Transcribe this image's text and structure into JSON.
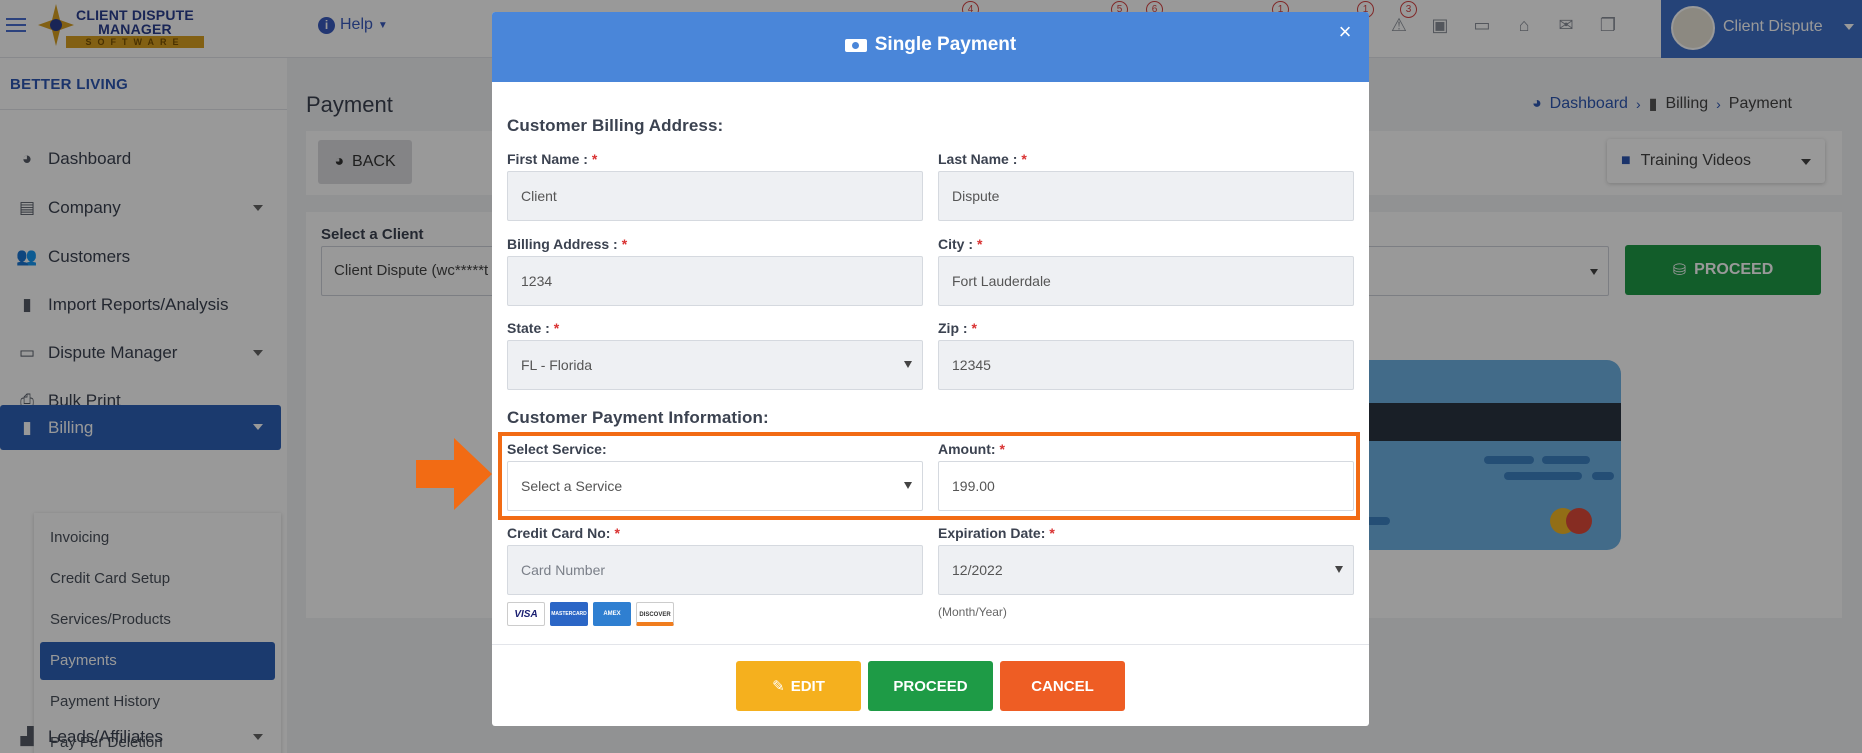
{
  "topbar": {
    "logo_line1": "CLIENT DISPUTE",
    "logo_line2": "MANAGER",
    "logo_line3": "SOFTWARE",
    "help_label": "Help",
    "badges": [
      "4",
      "5",
      "6",
      "1",
      "1",
      "3"
    ],
    "user_name": "Client Dispute"
  },
  "sidebar": {
    "org_name": "BETTER LIVING",
    "items": [
      {
        "label": "Dashboard",
        "icon": "dashboard-icon"
      },
      {
        "label": "Company",
        "icon": "building-icon"
      },
      {
        "label": "Customers",
        "icon": "users-icon"
      },
      {
        "label": "Import Reports/Analysis",
        "icon": "file-import-icon"
      },
      {
        "label": "Dispute Manager",
        "icon": "laptop-icon"
      },
      {
        "label": "Bulk Print",
        "icon": "print-icon"
      },
      {
        "label": "Billing",
        "icon": "billing-icon"
      },
      {
        "label": "Leads/Affiliates",
        "icon": "chart-icon"
      }
    ],
    "billing_submenu": [
      "Invoicing",
      "Credit Card Setup",
      "Services/Products",
      "Payments",
      "Payment History",
      "Pay Per Deletion"
    ]
  },
  "main": {
    "page_title": "Payment",
    "breadcrumb": [
      "Dashboard",
      "Billing",
      "Payment"
    ],
    "back_label": "BACK",
    "training_videos_label": "Training Videos",
    "select_client_label": "Select a Client",
    "select_client_value": "Client Dispute (wc*****t",
    "proceed_label": "PROCEED"
  },
  "modal": {
    "title": "Single Payment",
    "billing_section_title": "Customer Billing Address:",
    "first_name_label": "First Name :",
    "first_name_value": "Client",
    "last_name_label": "Last Name :",
    "last_name_value": "Dispute",
    "billing_address_label": "Billing Address :",
    "billing_address_value": "1234",
    "city_label": "City :",
    "city_value": "Fort Lauderdale",
    "state_label": "State :",
    "state_value": "FL - Florida",
    "zip_label": "Zip :",
    "zip_value": "12345",
    "payment_section_title": "Customer Payment Information:",
    "select_service_label": "Select Service:",
    "select_service_value": "Select a Service",
    "amount_label": "Amount:",
    "amount_value": "199.00",
    "card_no_label": "Credit Card No:",
    "card_no_placeholder": "Card Number",
    "expiration_label": "Expiration Date:",
    "expiration_value": "12/2022",
    "expiration_hint": "(Month/Year)",
    "card_brands": [
      "VISA",
      "MASTERCARD",
      "AMEX",
      "DISCOVER"
    ],
    "edit_label": "EDIT",
    "proceed_label": "PROCEED",
    "cancel_label": "CANCEL"
  },
  "colors": {
    "brand_blue": "#2d62b8",
    "modal_header": "#4a86d9",
    "edit": "#f5b01e",
    "proceed": "#1e9b46",
    "cancel": "#ee5d24",
    "highlight": "#f26b14"
  }
}
